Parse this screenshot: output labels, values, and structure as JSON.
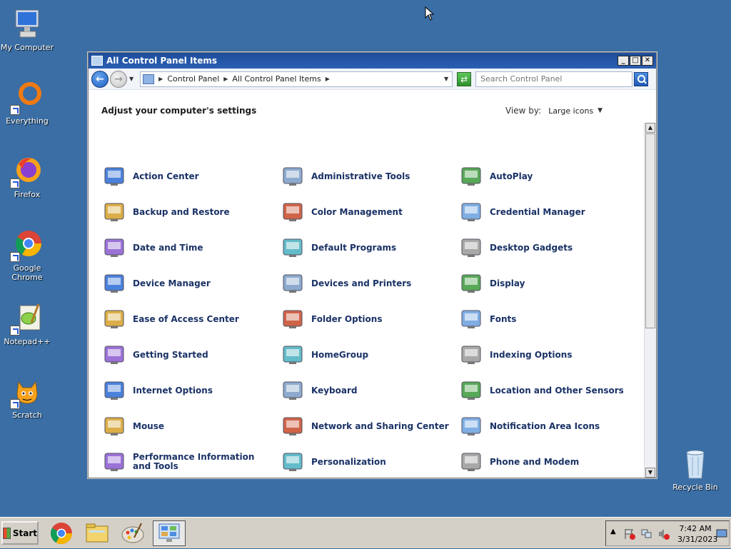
{
  "desktop": {
    "icons": [
      {
        "label": "My Computer"
      },
      {
        "label": "Everything"
      },
      {
        "label": "Firefox"
      },
      {
        "label": "Google Chrome"
      },
      {
        "label": "Notepad++"
      },
      {
        "label": "Scratch"
      },
      {
        "label": "Recycle Bin"
      }
    ]
  },
  "window": {
    "title": "All Control Panel Items",
    "address": {
      "crumbs": [
        "Control Panel",
        "All Control Panel Items"
      ]
    },
    "search_placeholder": "Search Control Panel",
    "heading": "Adjust your computer's settings",
    "view_by_label": "View by:",
    "view_by_value": "Large icons"
  },
  "items": [
    {
      "label": "Action Center",
      "icon": "flag-icon"
    },
    {
      "label": "Administrative Tools",
      "icon": "admin-tools-icon"
    },
    {
      "label": "AutoPlay",
      "icon": "autoplay-icon"
    },
    {
      "label": "Backup and Restore",
      "icon": "backup-icon"
    },
    {
      "label": "Color Management",
      "icon": "color-management-icon"
    },
    {
      "label": "Credential Manager",
      "icon": "credential-icon"
    },
    {
      "label": "Date and Time",
      "icon": "calendar-clock-icon"
    },
    {
      "label": "Default Programs",
      "icon": "default-programs-icon"
    },
    {
      "label": "Desktop Gadgets",
      "icon": "gadgets-icon"
    },
    {
      "label": "Device Manager",
      "icon": "device-manager-icon"
    },
    {
      "label": "Devices and Printers",
      "icon": "printer-icon"
    },
    {
      "label": "Display",
      "icon": "monitor-icon"
    },
    {
      "label": "Ease of Access Center",
      "icon": "ease-access-icon"
    },
    {
      "label": "Folder Options",
      "icon": "folder-icon"
    },
    {
      "label": "Fonts",
      "icon": "fonts-icon"
    },
    {
      "label": "Getting Started",
      "icon": "getting-started-icon"
    },
    {
      "label": "HomeGroup",
      "icon": "homegroup-icon"
    },
    {
      "label": "Indexing Options",
      "icon": "indexing-icon"
    },
    {
      "label": "Internet Options",
      "icon": "internet-icon"
    },
    {
      "label": "Keyboard",
      "icon": "keyboard-icon"
    },
    {
      "label": "Location and Other Sensors",
      "icon": "location-icon"
    },
    {
      "label": "Mouse",
      "icon": "mouse-icon"
    },
    {
      "label": "Network and Sharing Center",
      "icon": "network-icon"
    },
    {
      "label": "Notification Area Icons",
      "icon": "notification-icon"
    },
    {
      "label": "Performance Information and Tools",
      "icon": "performance-icon"
    },
    {
      "label": "Personalization",
      "icon": "personalization-icon"
    },
    {
      "label": "Phone and Modem",
      "icon": "phone-icon"
    }
  ],
  "taskbar": {
    "start_label": "Start",
    "time": "7:42 AM",
    "date": "3/31/2023"
  },
  "colors": {
    "desktop_bg": "#3a6ea5",
    "item_label": "#1a3266",
    "title_bar": "#1c4d9b"
  }
}
